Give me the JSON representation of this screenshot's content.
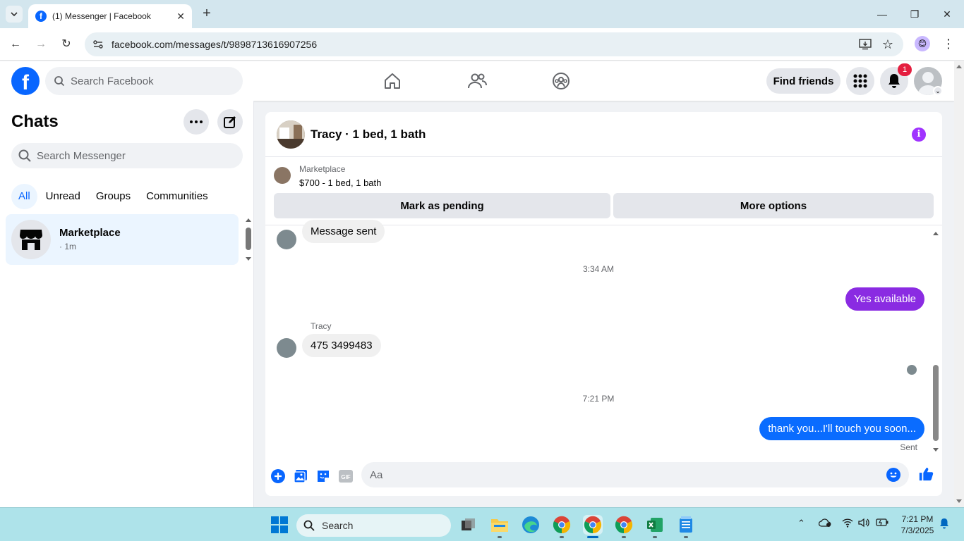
{
  "browser": {
    "tab_title": "(1) Messenger | Facebook",
    "url": "facebook.com/messages/t/9898713616907256"
  },
  "fb_header": {
    "search_placeholder": "Search Facebook",
    "find_friends": "Find friends",
    "notification_count": "1"
  },
  "chats": {
    "title": "Chats",
    "search_placeholder": "Search Messenger",
    "filters": [
      "All",
      "Unread",
      "Groups",
      "Communities"
    ],
    "active_filter": "All",
    "conversations": [
      {
        "name": "Marketplace",
        "time": "· 1m"
      }
    ]
  },
  "conversation": {
    "title": "Tracy · 1 bed, 1 bath",
    "marketplace_label": "Marketplace",
    "listing": "$700 - 1 bed, 1 bath",
    "mark_pending": "Mark as pending",
    "more_options": "More options",
    "messages": {
      "m1": "Message sent",
      "time1": "3:34 AM",
      "m2": "Yes available",
      "sender": "Tracy",
      "m3": "475 3499483",
      "time2": "7:21 PM",
      "m4": "thank you...I'll touch you soon...",
      "status": "Sent"
    },
    "composer_placeholder": "Aa"
  },
  "taskbar": {
    "search": "Search",
    "time": "7:21 PM",
    "date": "7/3/2025"
  },
  "colors": {
    "fb_blue": "#0866ff",
    "purple_bubble": "#8a2be2",
    "blue_bubble": "#0a6cff"
  }
}
